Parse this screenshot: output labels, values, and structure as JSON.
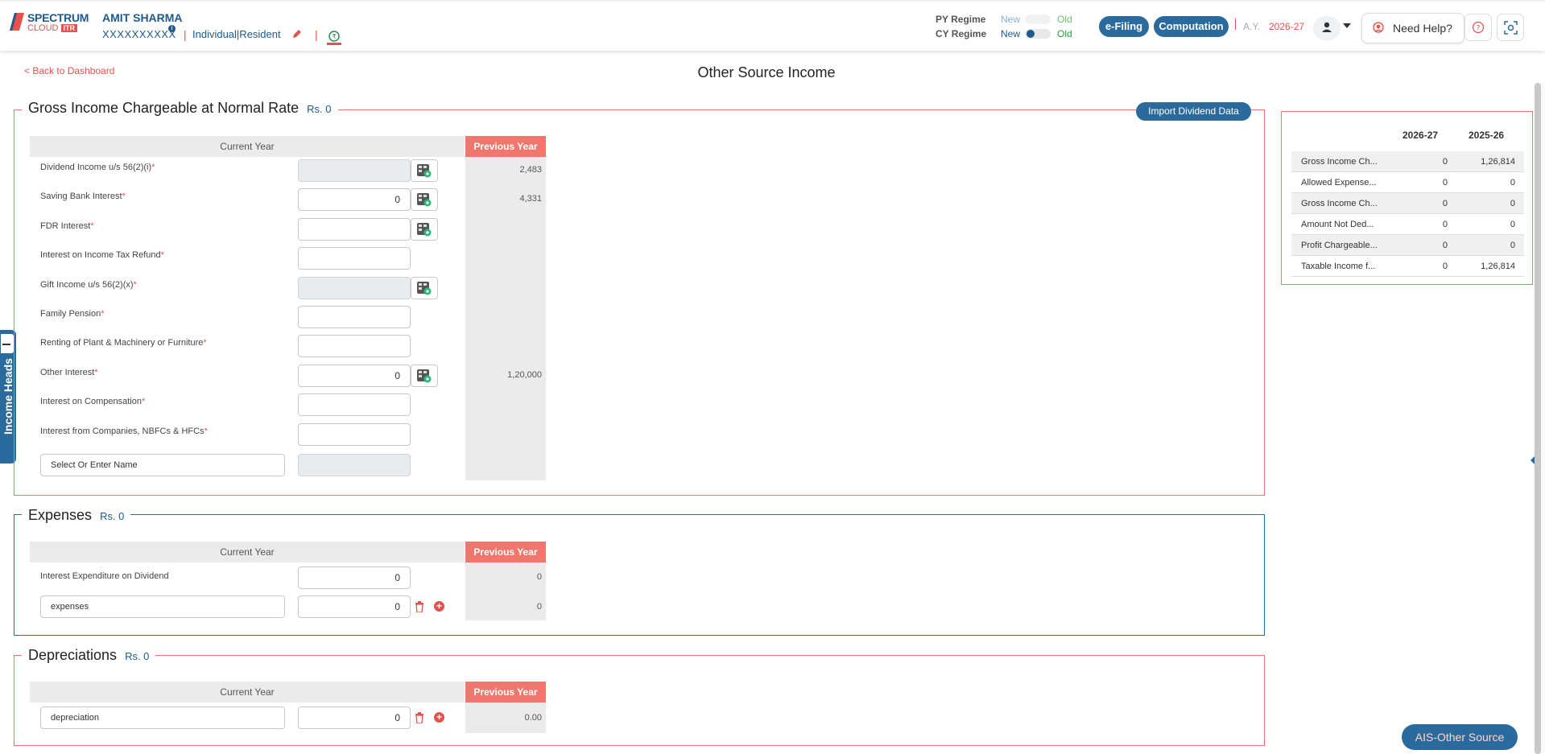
{
  "header": {
    "logo_line1": "SPECTRUM",
    "logo_line2": "CLOUD",
    "logo_badge": "ITR",
    "user_name": "AMIT SHARMA",
    "pan": "XXXXXXXXXX",
    "status": "Individual|Resident",
    "py_regime_label": "PY Regime",
    "cy_regime_label": "CY Regime",
    "new_label": "New",
    "old_label": "Old",
    "efiling_label": "e-Filing",
    "computation_label": "Computation",
    "ay_label": "A.Y.",
    "ay_value": "2026-27",
    "need_help_label": "Need Help?"
  },
  "page": {
    "back_label": "< Back to Dashboard",
    "title": "Other Source Income",
    "side_tab_label": "Income Heads"
  },
  "gross": {
    "title": "Gross Income Chargeable at Normal Rate",
    "amount": "Rs.  0",
    "import_label": "Import Dividend Data",
    "current_year_label": "Current Year",
    "previous_year_label": "Previous Year",
    "rows": [
      {
        "label": "Dividend Income u/s 56(2)(i)",
        "req": "*",
        "value": "",
        "disabled": true,
        "calc": true,
        "py": "2,483"
      },
      {
        "label": "Saving Bank Interest",
        "req": "*",
        "value": "0",
        "disabled": false,
        "calc": true,
        "py": "4,331"
      },
      {
        "label": "FDR Interest",
        "req": "*",
        "value": "",
        "disabled": false,
        "calc": true,
        "py": ""
      },
      {
        "label": "Interest on Income Tax Refund",
        "req": "*",
        "value": "",
        "disabled": false,
        "calc": false,
        "py": ""
      },
      {
        "label": "Gift Income u/s 56(2)(x)",
        "req": "*",
        "value": "",
        "disabled": true,
        "calc": true,
        "py": ""
      },
      {
        "label": "Family Pension",
        "req": "*",
        "value": "",
        "disabled": false,
        "calc": false,
        "py": ""
      },
      {
        "label": "Renting of Plant & Machinery or Furniture",
        "req": "*",
        "value": "",
        "disabled": false,
        "calc": false,
        "py": ""
      },
      {
        "label": "Other Interest",
        "req": "*",
        "value": "0",
        "disabled": false,
        "calc": true,
        "py": "1,20,000"
      },
      {
        "label": "Interest on Compensation",
        "req": "*",
        "value": "",
        "disabled": false,
        "calc": false,
        "py": ""
      },
      {
        "label": "Interest from Companies, NBFCs & HFCs",
        "req": "*",
        "value": "",
        "disabled": false,
        "calc": false,
        "py": ""
      }
    ],
    "select_name_placeholder": "Select Or Enter Name"
  },
  "expenses": {
    "title": "Expenses",
    "amount": "Rs.  0",
    "current_year_label": "Current Year",
    "previous_year_label": "Previous Year",
    "row1_label": "Interest Expenditure on Dividend",
    "row1_value": "0",
    "row1_py": "0",
    "row2_name": "expenses",
    "row2_value": "0",
    "row2_py": "0"
  },
  "depreciations": {
    "title": "Depreciations",
    "amount": "Rs.  0",
    "current_year_label": "Current Year",
    "previous_year_label": "Previous Year",
    "row_name": "depreciation",
    "row_value": "0",
    "row_py": "0.00"
  },
  "summary": {
    "col1": "2026-27",
    "col2": "2025-26",
    "rows": [
      {
        "name": "Gross Income Ch...",
        "v1": "0",
        "v2": "1,26,814"
      },
      {
        "name": "Allowed Expense...",
        "v1": "0",
        "v2": "0"
      },
      {
        "name": "Gross Income Ch...",
        "v1": "0",
        "v2": "0"
      },
      {
        "name": "Amount Not Ded...",
        "v1": "0",
        "v2": "0"
      },
      {
        "name": "Profit Chargeable...",
        "v1": "0",
        "v2": "0"
      },
      {
        "name": "Taxable Income f...",
        "v1": "0",
        "v2": "1,26,814"
      }
    ]
  },
  "ais_label": "AIS-Other Source",
  "colors": {
    "brand_blue": "#2b6a9c",
    "accent_red": "#e4524c",
    "prev_year_header": "#f0766e"
  }
}
